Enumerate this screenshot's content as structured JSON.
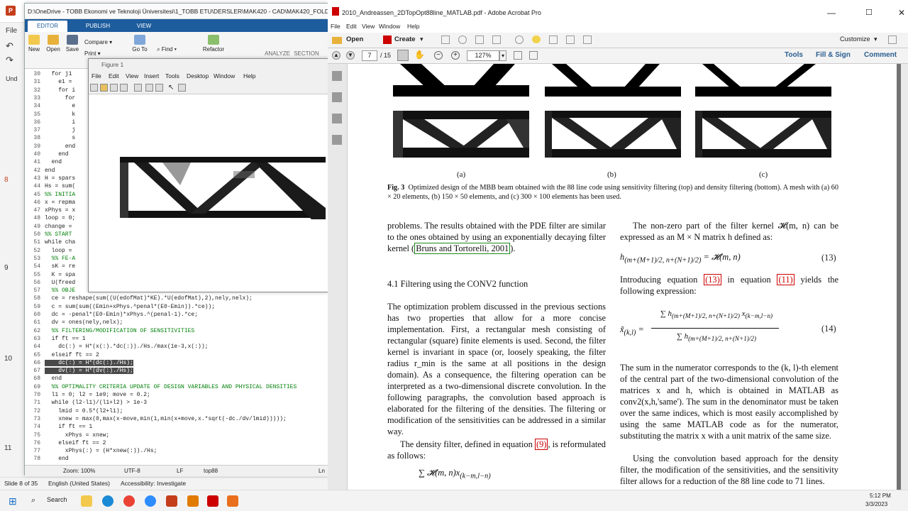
{
  "ppt": {
    "side_labels": [
      "File",
      "Und"
    ],
    "slide_numbers": [
      "8",
      "9",
      "10",
      "11"
    ],
    "status": {
      "slide": "Slide 8 of 35",
      "language": "English (United States)",
      "accessibility": "Accessibility: Investigate"
    }
  },
  "matlab": {
    "path": "D:\\OneDrive - TOBB Ekonomi ve Teknoloji Üniversitesi\\1_TOBB ETU\\DERSLER\\MAK420 - CAD\\MAK420_FOLDER\\Pap",
    "tabs": [
      "EDITOR",
      "PUBLISH",
      "VIEW"
    ],
    "toolbar": {
      "new": "New",
      "open": "Open",
      "save": "Save",
      "compare": "Compare",
      "print": "Print",
      "goto": "Go To",
      "find": "Find",
      "refactor": "Refactor",
      "analyze": "ANALYZE",
      "section": "SECTION"
    },
    "code_lines": [
      {
        "n": "30",
        "t": "  for j1"
      },
      {
        "n": "31",
        "t": "    e1 ="
      },
      {
        "n": "32",
        "t": "    for i"
      },
      {
        "n": "33",
        "t": "      for"
      },
      {
        "n": "34",
        "t": "        e"
      },
      {
        "n": "35",
        "t": "        k"
      },
      {
        "n": "36",
        "t": "        i"
      },
      {
        "n": "37",
        "t": "        j"
      },
      {
        "n": "38",
        "t": "        s"
      },
      {
        "n": "39",
        "t": "      end"
      },
      {
        "n": "40",
        "t": "    end"
      },
      {
        "n": "41",
        "t": "  end"
      },
      {
        "n": "42",
        "t": "end"
      },
      {
        "n": "43",
        "t": "H = spars"
      },
      {
        "n": "44",
        "t": "Hs = sum("
      },
      {
        "n": "45",
        "t": "%% INITIA",
        "c": true
      },
      {
        "n": "46",
        "t": "x = repma"
      },
      {
        "n": "47",
        "t": "xPhys = x"
      },
      {
        "n": "48",
        "t": "loop = 0;"
      },
      {
        "n": "49",
        "t": "change ="
      },
      {
        "n": "50",
        "t": "%% START",
        "c": true
      },
      {
        "n": "51",
        "t": "while cha"
      },
      {
        "n": "52",
        "t": "  loop ="
      },
      {
        "n": "53",
        "t": "  %% FE-A",
        "c": true
      },
      {
        "n": "54",
        "t": "  sK = re"
      },
      {
        "n": "55",
        "t": "  K = spa"
      },
      {
        "n": "56",
        "t": "  U(freed"
      },
      {
        "n": "57",
        "t": "  %% OBJE",
        "c": true
      },
      {
        "n": "58",
        "t": "  ce = reshape(sum((U(edofMat)*KE).*U(edofMat),2),nely,nelx);"
      },
      {
        "n": "59",
        "t": "  c = sum(sum((Emin+xPhys.^penal*(E0-Emin)).*ce));"
      },
      {
        "n": "60",
        "t": "  dc = -penal*(E0-Emin)*xPhys.^(penal-1).*ce;"
      },
      {
        "n": "61",
        "t": "  dv = ones(nely,nelx);"
      },
      {
        "n": "62",
        "t": "  %% FILTERING/MODIFICATION OF SENSITIVITIES",
        "c": true
      },
      {
        "n": "63",
        "t": "  if ft == 1"
      },
      {
        "n": "64",
        "t": "    dc(:) = H*(x(:).*dc(:))./Hs./max(1e-3,x(:));"
      },
      {
        "n": "65",
        "t": "  elseif ft == 2"
      },
      {
        "n": "66",
        "t": "    dc(:) = H*(dc(:)./Hs);",
        "s": true
      },
      {
        "n": "67",
        "t": "    dv(:) = H*(dv(:)./Hs);",
        "s": true
      },
      {
        "n": "68",
        "t": "  end"
      },
      {
        "n": "69",
        "t": "  %% OPTIMALITY CRITERIA UPDATE OF DESIGN VARIABLES AND PHYSICAL DENSITIES",
        "c": true
      },
      {
        "n": "70",
        "t": "  l1 = 0; l2 = 1e9; move = 0.2;"
      },
      {
        "n": "71",
        "t": "  while (l2-l1)/(l1+l2) > 1e-3"
      },
      {
        "n": "72",
        "t": "    lmid = 0.5*(l2+l1);"
      },
      {
        "n": "73",
        "t": "    xnew = max(0,max(x-move,min(1,min(x+move,x.*sqrt(-dc./dv/lmid)))));"
      },
      {
        "n": "74",
        "t": "    if ft == 1"
      },
      {
        "n": "75",
        "t": "      xPhys = xnew;"
      },
      {
        "n": "76",
        "t": "    elseif ft == 2"
      },
      {
        "n": "77",
        "t": "      xPhys(:) = (H*xnew(:))./Hs;"
      },
      {
        "n": "78",
        "t": "    end"
      }
    ],
    "status": {
      "zoom": "Zoom: 100%",
      "encoding": "UTF-8",
      "eol": "LF",
      "file": "top88",
      "ln": "Ln"
    }
  },
  "figure": {
    "title": "Figure 1",
    "menu": [
      "File",
      "Edit",
      "View",
      "Insert",
      "Tools",
      "Desktop",
      "Window",
      "Help"
    ]
  },
  "acrobat": {
    "title": "2010_Andreassen_2DTopOpt88line_MATLAB.pdf - Adobe Acrobat Pro",
    "menu": [
      "File",
      "Edit",
      "View",
      "Window",
      "Help"
    ],
    "open": "Open",
    "create": "Create",
    "customize": "Customize",
    "page_current": "7",
    "page_total": "/ 15",
    "zoom": "127%",
    "tools": "Tools",
    "fill_sign": "Fill & Sign",
    "comment": "Comment"
  },
  "pdf": {
    "subfig": [
      "(a)",
      "(b)",
      "(c)"
    ],
    "caption_bold": "Fig. 3",
    "caption": "Optimized design of the MBB beam obtained with the 88 line code using sensitivity filtering (top) and density filtering (bottom). A mesh with (a) 60 × 20 elements, (b) 150 × 50 elements, and (c) 300 × 100 elements has been used.",
    "left_p1a": "problems. The results obtained with the PDE filter are similar to the ones obtained by using an exponentially decaying filter kernel (",
    "left_p1_ref": "Bruns and Tortorelli, 2001",
    "left_p1b": ").",
    "section": "4.1 Filtering using the CONV2 function",
    "left_p2": "The optimization problem discussed in the previous sections has two properties that allow for a more concise implementation. First, a rectangular mesh consisting of rectangular (square) finite elements is used. Second, the filter kernel is invariant in space (or, loosely speaking, the filter radius r_min is the same at all positions in the design domain). As a consequence, the filtering operation can be interpreted as a two-dimensional discrete convolution. In the following paragraphs, the convolution based approach is elaborated for the filtering of the densities. The filtering or modification of the sensitivities can be addressed in a similar way.",
    "left_p3a": "The density filter, defined in equation ",
    "left_p3_ref": "(9)",
    "left_p3b": ", is reformulated as follows:",
    "right_p1": "The non-zero part of the filter kernel 𝓗(m, n) can be expressed as an M × N matrix h defined as:",
    "eq13": "(13)",
    "right_p2a": "Introducing equation ",
    "right_p2_ref1": "(13)",
    "right_p2b": " in equation ",
    "right_p2_ref2": "(11)",
    "right_p2c": " yields the following expression:",
    "eq14": "(14)",
    "right_p3": "The sum in the numerator corresponds to the (k, l)-th element of the central part of the two-dimensional convolution of the matrices x and h, which is obtained in MATLAB as conv2(x,h,'same'). The sum in the denominator must be taken over the same indices, which is most easily accomplished by using the same MATLAB code as for the numerator, substituting the matrix x with a unit matrix of the same size.",
    "right_p4": "Using the convolution based approach for the density filter, the modification of the sensitivities, and the sensitivity filter allows for a reduction of the 88 line code to 71 lines."
  },
  "taskbar": {
    "search": "Search",
    "time": "5:12 PM",
    "date": "3/3/2023"
  }
}
